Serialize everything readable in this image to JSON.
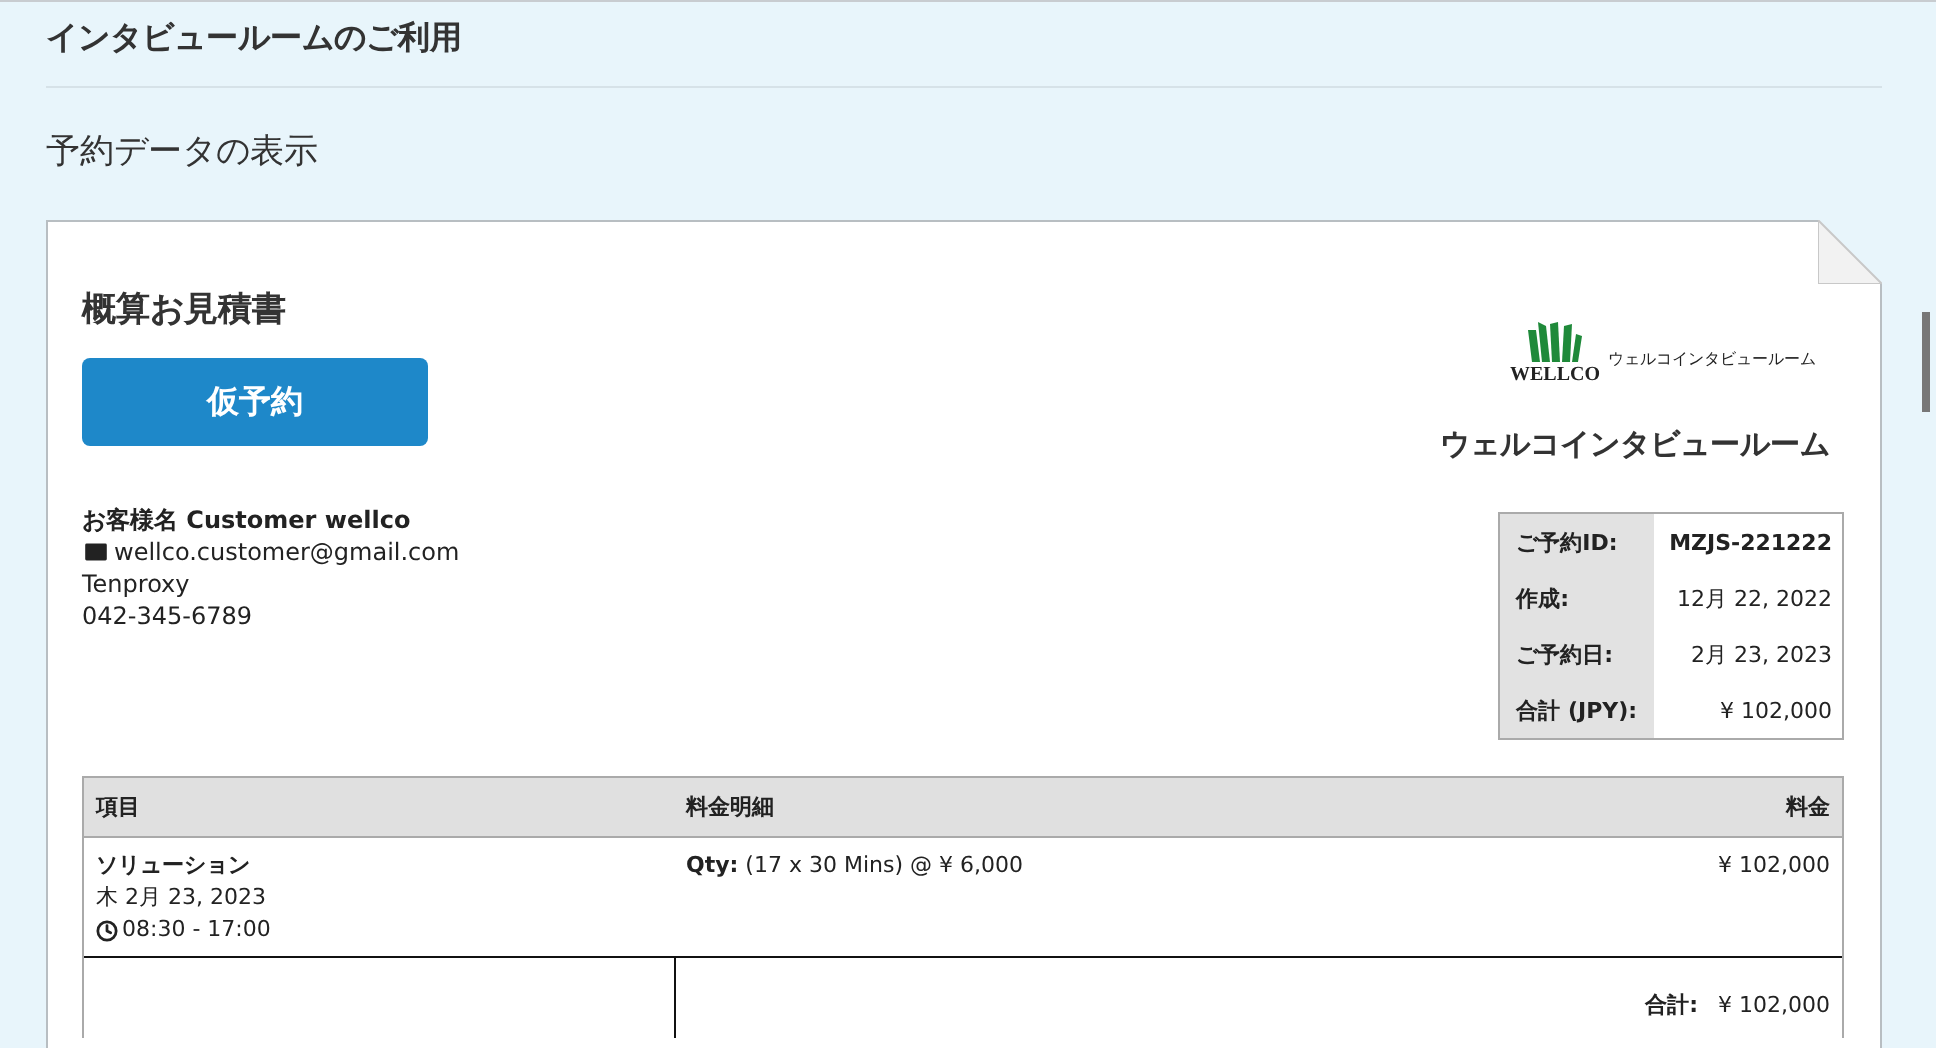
{
  "page": {
    "title": "インタビュールームのご利用",
    "section_title": "予約データの表示"
  },
  "quote": {
    "title": "概算お見積書",
    "button": "仮予約",
    "customer": {
      "name": "お客様名 Customer wellco",
      "email": "wellco.customer@gmail.com",
      "company": "Tenproxy",
      "phone": "042-345-6789"
    },
    "logo": {
      "mark": "WELLCO",
      "tagline": "ウェルコインタビュールーム"
    },
    "company_name": "ウェルコインタビュールーム",
    "info": [
      {
        "label": "ご予約ID:",
        "value": "MZJS-221222"
      },
      {
        "label": "作成:",
        "value": "12月 22, 2022"
      },
      {
        "label": "ご予約日:",
        "value": "2月 23, 2023"
      },
      {
        "label": "合計 (JPY):",
        "value": "¥ 102,000"
      }
    ],
    "table": {
      "columns": [
        "項目",
        "料金明細",
        "料金"
      ],
      "rows": [
        {
          "item": "ソリューション",
          "date": "木 2月 23, 2023",
          "time": "08:30 - 17:00",
          "detail": "**Qty:** (17 x 30 Mins) @ ¥ 6,000",
          "amount": "¥ 102,000"
        }
      ],
      "total_label": "合計:",
      "total": "¥ 102,000"
    }
  }
}
